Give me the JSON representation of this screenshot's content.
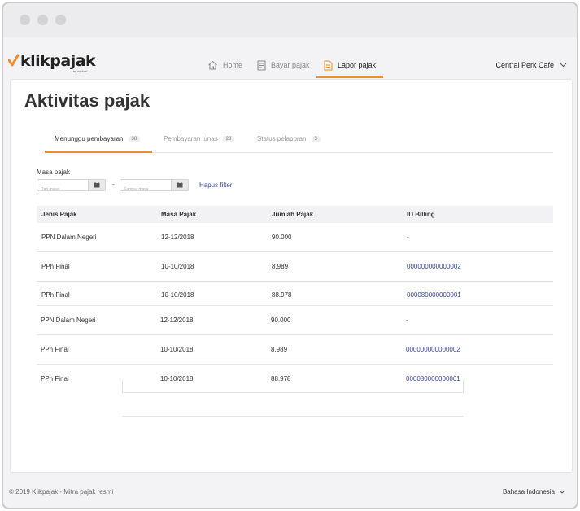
{
  "header": {
    "brand": "klikpajak",
    "brand_sub": "by mekari",
    "nav": [
      {
        "label": "Home",
        "icon": "home-icon"
      },
      {
        "label": "Bayar pajak",
        "icon": "receipt-icon"
      },
      {
        "label": "Lapor pajak",
        "icon": "report-icon",
        "active": true
      }
    ],
    "company": "Central Perk Cafe"
  },
  "page": {
    "title": "Aktivitas pajak",
    "tabs": [
      {
        "label": "Menunggu pembayaran",
        "count": "38",
        "active": true
      },
      {
        "label": "Pembayaran lunas",
        "count": "28"
      },
      {
        "label": "Status pelaporan",
        "count": "3"
      }
    ],
    "filter": {
      "label": "Masa pajak",
      "from_placeholder": "Dari masa",
      "to_placeholder": "Sampai masa",
      "separator": "-",
      "reset": "Hapus filter"
    },
    "table": {
      "columns": [
        "Jenis Pajak",
        "Masa Pajak",
        "Jumlah Pajak",
        "ID Billing"
      ],
      "rows": [
        [
          "PPN Dalam Negeri",
          "12-12/2018",
          "90.000",
          "-"
        ],
        [
          "PPh Final",
          "10-10/2018",
          "8.989",
          "000000000000002"
        ],
        [
          "PPh Final",
          "10-10/2018",
          "88.978",
          "000080000000001"
        ],
        [
          "PPN Dalam Negeri",
          "12-12/2018",
          "90.000",
          "-"
        ],
        [
          "PPh Final",
          "10-10/2018",
          "8.989",
          "000000000000002"
        ],
        [
          "PPh Final",
          "10-10/2018",
          "88.978",
          "000080000000001"
        ]
      ]
    }
  },
  "footer": {
    "copyright": "© 2019 Klikpajak - Mitra pajak resmi",
    "language": "Bahasa Indonesia"
  },
  "colors": {
    "accent": "#f28b2b",
    "link": "#3b47a6"
  }
}
